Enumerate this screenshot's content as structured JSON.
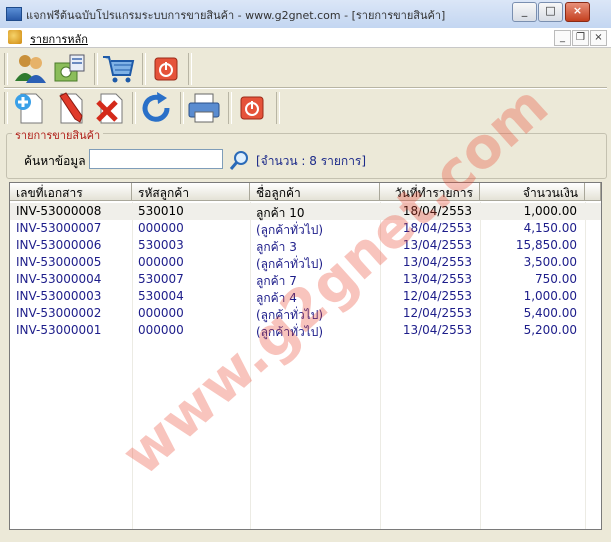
{
  "window": {
    "title": "แจกฟรีต้นฉบับโปรแกรมระบบการขายสินค้า - www.g2gnet.com - [รายการขายสินค้า]",
    "minimize": "_",
    "maximize": "□",
    "close": "×"
  },
  "menu": {
    "label": "รายการหลัก",
    "mdi_min": "_",
    "mdi_restore": "❐",
    "mdi_close": "×"
  },
  "toolbar1": [
    "customers-icon",
    "products-icon",
    "cart-icon",
    "exit-icon"
  ],
  "toolbar2": [
    "add-icon",
    "edit-icon",
    "delete-icon",
    "refresh-icon",
    "print-icon",
    "exit-icon"
  ],
  "group": {
    "title": "รายการขายสินค้า"
  },
  "search": {
    "label": "ค้นหาข้อมูล",
    "value": "",
    "count_text": "[จำนวน : 8 รายการ]"
  },
  "table": {
    "headers": [
      "เลขที่เอกสาร",
      "รหัสลูกค้า",
      "ชื่อลูกค้า",
      "วันที่ทำรายการ",
      "จำนวนเงิน"
    ],
    "rows": [
      {
        "doc": "INV-53000008",
        "code": "530010",
        "name": "ลูกค้า 10",
        "date": "18/04/2553",
        "amount": "1,000.00"
      },
      {
        "doc": "INV-53000007",
        "code": "000000",
        "name": "(ลูกค้าทั่วไป)",
        "date": "18/04/2553",
        "amount": "4,150.00"
      },
      {
        "doc": "INV-53000006",
        "code": "530003",
        "name": "ลูกค้า 3",
        "date": "13/04/2553",
        "amount": "15,850.00"
      },
      {
        "doc": "INV-53000005",
        "code": "000000",
        "name": "(ลูกค้าทั่วไป)",
        "date": "13/04/2553",
        "amount": "3,500.00"
      },
      {
        "doc": "INV-53000004",
        "code": "530007",
        "name": "ลูกค้า 7",
        "date": "13/04/2553",
        "amount": "750.00"
      },
      {
        "doc": "INV-53000003",
        "code": "530004",
        "name": "ลูกค้า 4",
        "date": "12/04/2553",
        "amount": "1,000.00"
      },
      {
        "doc": "INV-53000002",
        "code": "000000",
        "name": "(ลูกค้าทั่วไป)",
        "date": "12/04/2553",
        "amount": "5,400.00"
      },
      {
        "doc": "INV-53000001",
        "code": "000000",
        "name": "(ลูกค้าทั่วไป)",
        "date": "13/04/2553",
        "amount": "5,200.00"
      }
    ]
  },
  "watermark": "www.g2gnet.com",
  "colors": {
    "row_text": "#1d1d8a",
    "selected_row_bg": "#f0efea",
    "group_title": "#b0201a"
  }
}
